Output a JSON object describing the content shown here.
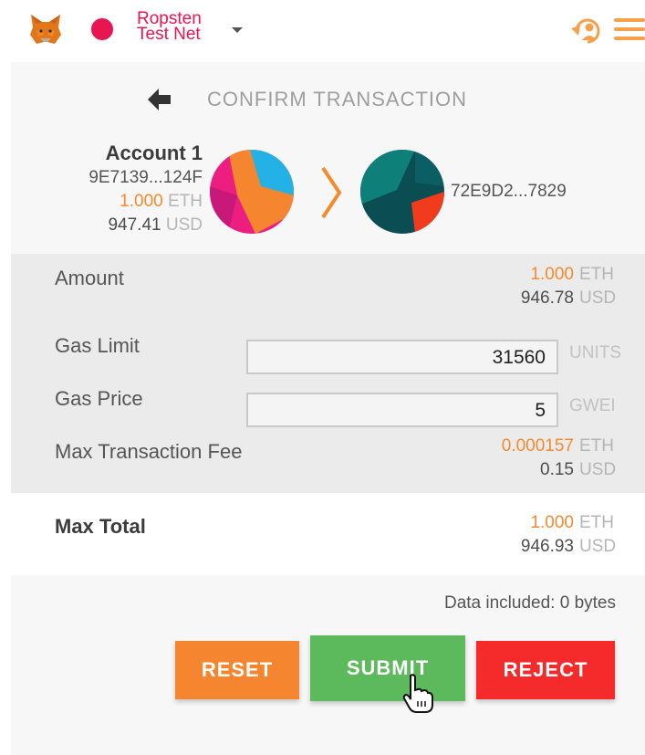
{
  "header": {
    "network_line1": "Ropsten",
    "network_line2": "Test Net",
    "icons": [
      "metamask-fox-icon",
      "account-switch-icon",
      "hamburger-menu-icon"
    ],
    "network_color": "#e91550",
    "accent_color": "#f58a2e"
  },
  "page": {
    "title": "CONFIRM TRANSACTION"
  },
  "from": {
    "account_name": "Account 1",
    "address": "9E7139...124F",
    "eth_amount": "1.000",
    "eth_unit": "ETH",
    "usd_amount": "947.41",
    "usd_unit": "USD"
  },
  "to": {
    "address": "72E9D2...7829"
  },
  "details": {
    "amount_label": "Amount",
    "amount_eth": "1.000",
    "amount_eth_unit": "ETH",
    "amount_usd": "946.78",
    "amount_usd_unit": "USD",
    "gas_limit_label": "Gas Limit",
    "gas_limit_value": "31560",
    "gas_limit_unit": "UNITS",
    "gas_price_label": "Gas Price",
    "gas_price_value": "5",
    "gas_price_unit": "GWEI",
    "max_fee_label": "Max Transaction Fee",
    "max_fee_eth": "0.000157",
    "max_fee_eth_unit": "ETH",
    "max_fee_usd": "0.15",
    "max_fee_usd_unit": "USD"
  },
  "total": {
    "label": "Max Total",
    "eth": "1.000",
    "eth_unit": "ETH",
    "usd": "946.93",
    "usd_unit": "USD"
  },
  "footer": {
    "data_included": "Data included: 0 bytes",
    "reset_label": "RESET",
    "submit_label": "SUBMIT",
    "reject_label": "REJECT",
    "reset_color": "#f5852f",
    "submit_color": "#5cba5c",
    "reject_color": "#f52b2b"
  }
}
